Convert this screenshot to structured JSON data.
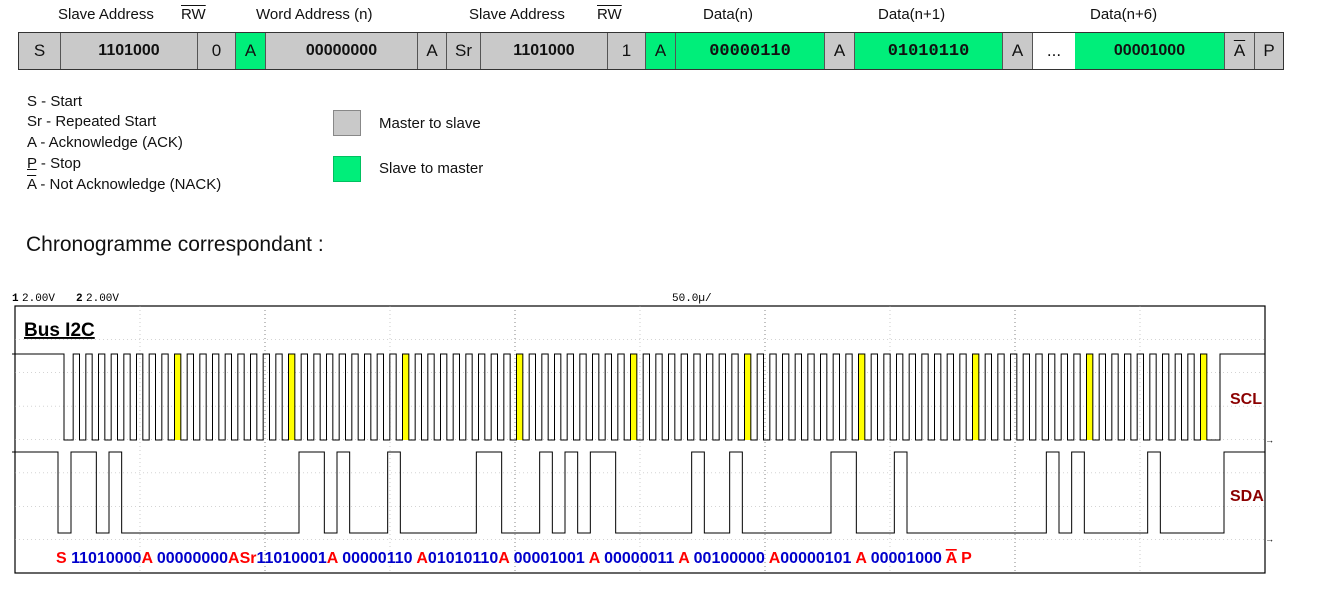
{
  "frame": {
    "headers": {
      "slave_address_1": "Slave Address",
      "rw_1": "RW",
      "word_address": "Word Address (n)",
      "slave_address_2": "Slave Address",
      "rw_2": "RW",
      "data_n": "Data(n)",
      "data_n1": "Data(n+1)",
      "data_n6": "Data(n+6)"
    },
    "cells": {
      "start": "S",
      "slave_addr_1": "1101000",
      "rw_bit_1": "0",
      "ack_1": "A",
      "word_addr": "00000000",
      "ack_2": "A",
      "repeated_start": "Sr",
      "slave_addr_2": "1101000",
      "rw_bit_2": "1",
      "ack_3": "A",
      "data_n": "00000110",
      "ack_4": "A",
      "data_n1": "01010110",
      "ack_5": "A",
      "ellipsis": "...",
      "data_n6": "00001000",
      "nack": "A",
      "stop": "P"
    }
  },
  "legend": {
    "s": "S - Start",
    "sr": "Sr - Repeated Start",
    "a": "A - Acknowledge (ACK)",
    "p_letter": "P",
    "p_rest": " - Stop",
    "nack_letter": "A",
    "nack_rest": " - Not Acknowledge (NACK)",
    "master_to_slave": "Master to slave",
    "slave_to_master": "Slave to master"
  },
  "colors": {
    "master_to_slave": "#c9c9c9",
    "slave_to_master": "#00ee7a",
    "ack_highlight": "#ffff00",
    "decode_red": "#ff0000",
    "decode_blue": "#0000cc",
    "channel_label": "#8b0000"
  },
  "subtitle": "Chronogramme correspondant :",
  "scope": {
    "ch1_scale": "2.00V",
    "ch1_num": "1",
    "ch2_scale": "2.00V",
    "ch2_num": "2",
    "timebase": "50.0µ/",
    "title": "Bus I2C",
    "scl_label": "SCL",
    "sda_label": "SDA",
    "decode": [
      {
        "t": "S ",
        "c": "red"
      },
      {
        "t": "11010000",
        "c": "blue"
      },
      {
        "t": "A ",
        "c": "red"
      },
      {
        "t": "00000000",
        "c": "blue"
      },
      {
        "t": "ASr",
        "c": "red"
      },
      {
        "t": "11010001",
        "c": "blue"
      },
      {
        "t": "A ",
        "c": "red"
      },
      {
        "t": "00000110 ",
        "c": "blue"
      },
      {
        "t": "A",
        "c": "red"
      },
      {
        "t": "01010110",
        "c": "blue"
      },
      {
        "t": "A ",
        "c": "red"
      },
      {
        "t": "00001001 ",
        "c": "blue"
      },
      {
        "t": "A ",
        "c": "red"
      },
      {
        "t": "00000011 ",
        "c": "blue"
      },
      {
        "t": "A ",
        "c": "red"
      },
      {
        "t": "00100000 ",
        "c": "blue"
      },
      {
        "t": "A",
        "c": "red"
      },
      {
        "t": "00000101 ",
        "c": "blue"
      },
      {
        "t": "A ",
        "c": "red"
      },
      {
        "t": "00001000 ",
        "c": "blue"
      },
      {
        "t": "A",
        "c": "red",
        "ov": true
      },
      {
        "t": " P",
        "c": "red"
      }
    ]
  }
}
